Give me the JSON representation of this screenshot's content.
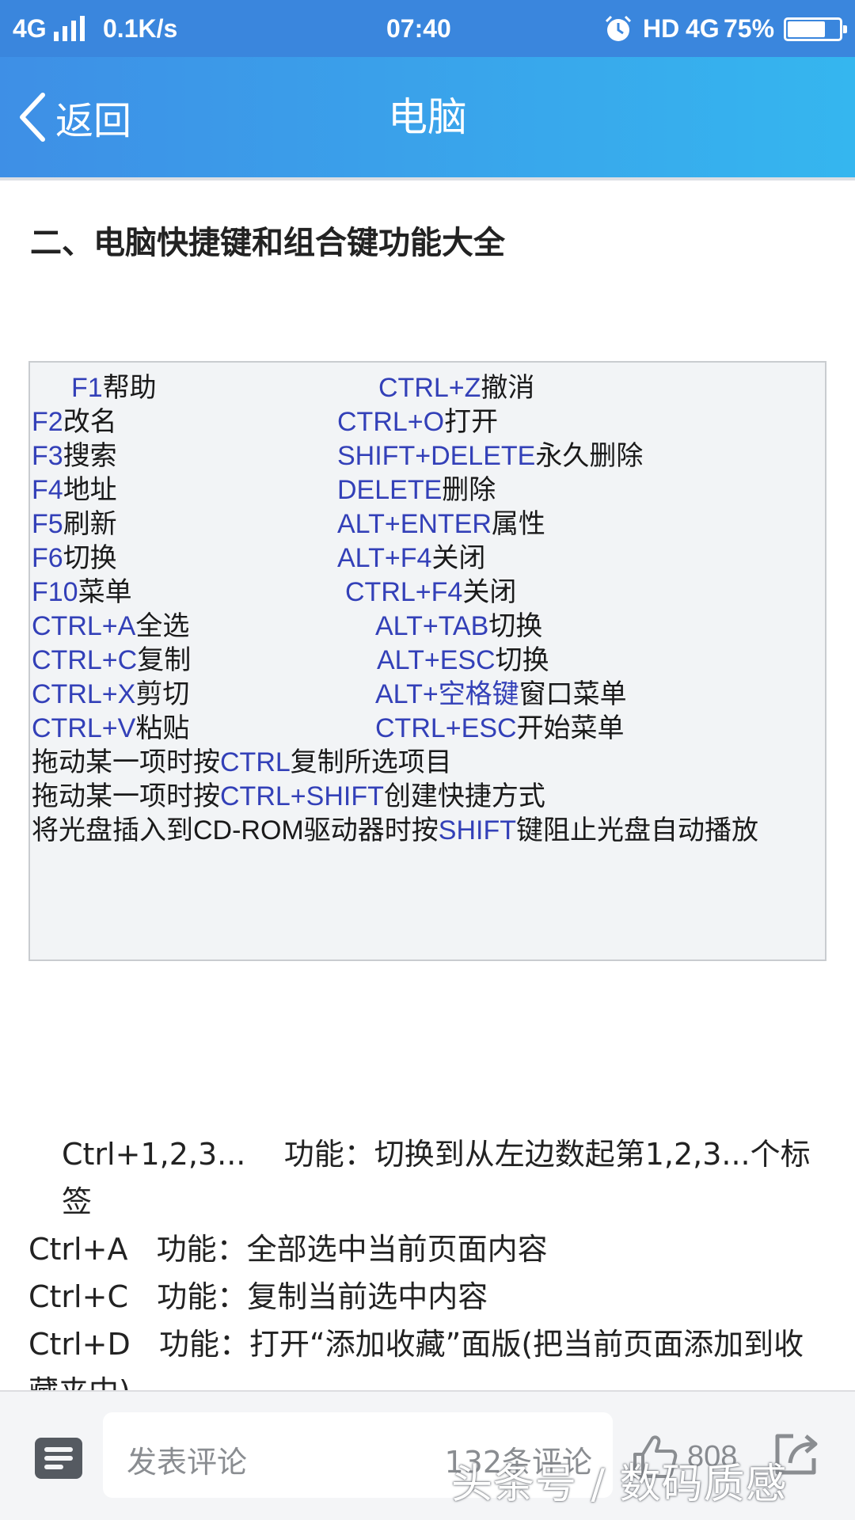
{
  "status_bar": {
    "network": "4G",
    "speed": "0.1K/s",
    "time": "07:40",
    "hd": "HD",
    "network_right": "4G",
    "battery": "75%",
    "battery_level": 0.75
  },
  "header": {
    "back_label": "返回",
    "title": "电脑"
  },
  "article": {
    "section_heading": "二、电脑快捷键和组合键功能大全",
    "shortcut_rows": [
      {
        "key": "F1",
        "desc": "帮助"
      },
      {
        "key": "CTRL+Z",
        "desc": "撤消"
      },
      {
        "key": "F2",
        "desc": "改名"
      },
      {
        "key": "CTRL+O",
        "desc": "打开"
      },
      {
        "key": "F3",
        "desc": "搜索"
      },
      {
        "key": "SHIFT+DELETE",
        "desc": "永久删除"
      },
      {
        "key": "F4",
        "desc": "地址"
      },
      {
        "key": "DELETE",
        "desc": "删除"
      },
      {
        "key": "F5",
        "desc": "刷新"
      },
      {
        "key": "ALT+ENTER",
        "desc": "属性"
      },
      {
        "key": "F6",
        "desc": "切换"
      },
      {
        "key": "ALT+F4",
        "desc": "关闭"
      },
      {
        "key": "F10",
        "desc": "菜单"
      },
      {
        "key": "CTRL+F4",
        "desc": "关闭"
      },
      {
        "key": "CTRL+A",
        "desc": "全选"
      },
      {
        "key": "ALT+TAB",
        "desc": "切换"
      },
      {
        "key": "CTRL+C",
        "desc": "复制"
      },
      {
        "key": "ALT+ESC",
        "desc": "切换"
      },
      {
        "key": "CTRL+X",
        "desc": "剪切"
      },
      {
        "key": "ALT+空格键",
        "desc": "窗口菜单"
      },
      {
        "key": "CTRL+V",
        "desc": "粘贴"
      },
      {
        "key": "CTRL+ESC",
        "desc": "开始菜单"
      }
    ],
    "long_rows": [
      {
        "pre": "拖动某一项时按",
        "key": "CTRL",
        "post": "复制所选项目"
      },
      {
        "pre": "拖动某一项时按",
        "key": "CTRL+SHIFT",
        "post": "创建快捷方式"
      },
      {
        "pre": "将光盘插入到CD-ROM驱动器时按",
        "key": "SHIFT",
        "post": "键阻止光盘自动播放"
      }
    ],
    "paragraphs": [
      "Ctrl+1,2,3...    功能：切换到从左边数起第1,2,3...个标签",
      "Ctrl+A   功能：全部选中当前页面内容",
      "Ctrl+C   功能：复制当前选中内容",
      "Ctrl+D   功能：打开“添加收藏”面版(把当前页面添加到收藏夹中)"
    ]
  },
  "bottom_bar": {
    "comment_placeholder": "发表评论",
    "comment_count": "132条评论",
    "like_count": "808",
    "watermark": "头条号 / 数码质感"
  }
}
